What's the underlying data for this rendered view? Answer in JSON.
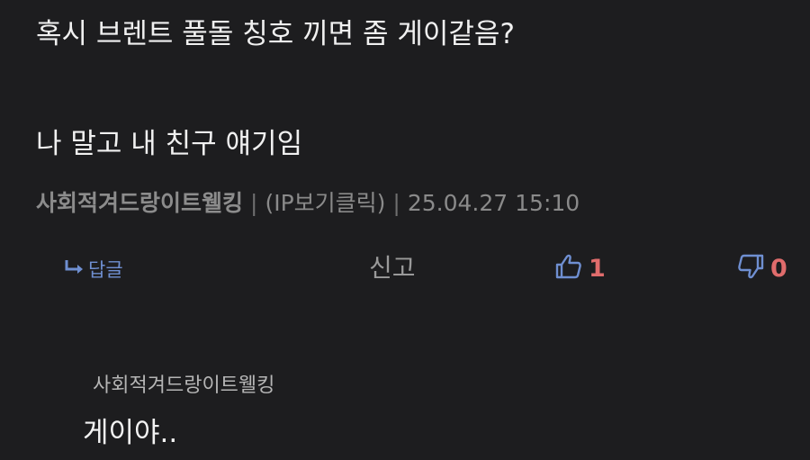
{
  "post": {
    "line1": "혹시 브렌트 풀돌 칭호 끼면 좀 게이같음?",
    "line2": "나 말고 내 친구 얘기임"
  },
  "meta": {
    "author": "사회적겨드랑이트웰킹",
    "separator": "|",
    "ip_link": "(IP보기클릭)",
    "timestamp": "25.04.27 15:10"
  },
  "actions": {
    "reply_label": "답글",
    "report_label": "신고",
    "like_count": "1",
    "dislike_count": "0",
    "accent_color": "#6f8fd1",
    "count_color": "#e06c6c"
  },
  "comment": {
    "author": "사회적겨드랑이트웰킹",
    "text": "게이야.."
  }
}
